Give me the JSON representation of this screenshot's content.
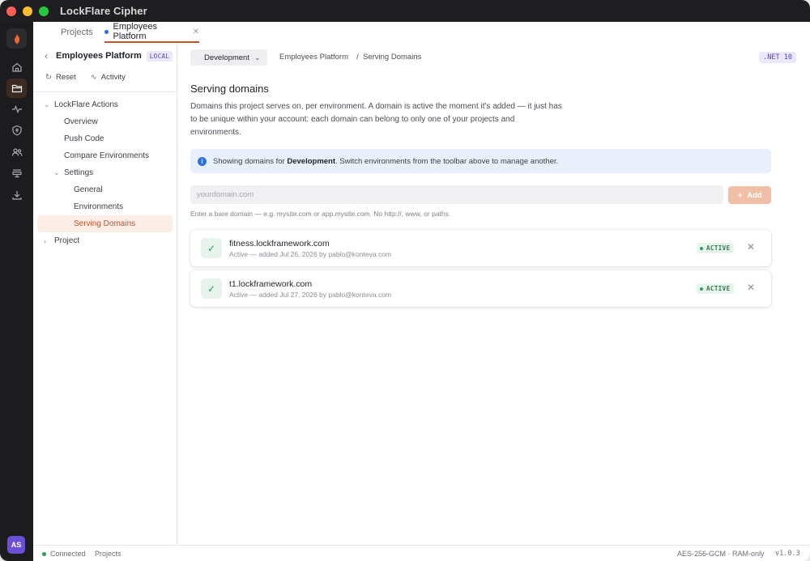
{
  "window": {
    "title": "LockFlare Cipher"
  },
  "tabs": [
    {
      "label": "Projects"
    },
    {
      "label": "Employees Platform"
    }
  ],
  "sidebar": {
    "project_name": "Employees Platform",
    "badge": "LOCAL",
    "actions": {
      "reset": "Reset",
      "activity": "Activity"
    },
    "tree": {
      "group": "LockFlare Actions",
      "overview": "Overview",
      "push_code": "Push Code",
      "compare": "Compare Environments",
      "settings": "Settings",
      "general": "General",
      "environments": "Environments",
      "serving_domains": "Serving Domains",
      "project": "Project"
    }
  },
  "rail": {
    "avatar": "AS"
  },
  "toolbar": {
    "environment": "Development",
    "breadcrumb_project": "Employees Platform",
    "breadcrumb_sep": "/",
    "breadcrumb_page": "Serving Domains",
    "runtime_badge": ".NET 10"
  },
  "main": {
    "title": "Serving domains",
    "description": "Domains this project serves on, per environment. A domain is active the moment it's added — it just has to be unique within your account: each domain can belong to only one of your projects and environments.",
    "info_prefix": "Showing domains for ",
    "info_env": "Development",
    "info_suffix": ". Switch environments from the toolbar above to manage another.",
    "input_placeholder": "yourdomain.com",
    "add_label": "Add",
    "hint": "Enter a bare domain — e.g. mysite.com or app.mysite.com. No http://, www, or paths.",
    "domains": [
      {
        "name": "fitness.lockframework.com",
        "meta": "Active — added Jul 26, 2026 by pablo@konteva.com",
        "status": "ACTIVE"
      },
      {
        "name": "t1.lockframework.com",
        "meta": "Active — added Jul 27, 2026 by pablo@konteva.com",
        "status": "ACTIVE"
      }
    ]
  },
  "statusbar": {
    "connection": "Connected",
    "projects": "Projects",
    "encryption": "AES-256-GCM · RAM-only",
    "version": "v1.0.3"
  },
  "colors": {
    "accent": "#c8512b",
    "titlebar": "#1e1e20",
    "rail": "#1c1c1e",
    "active_green": "#2f9b5c",
    "info_blue": "#2f6fe0"
  }
}
